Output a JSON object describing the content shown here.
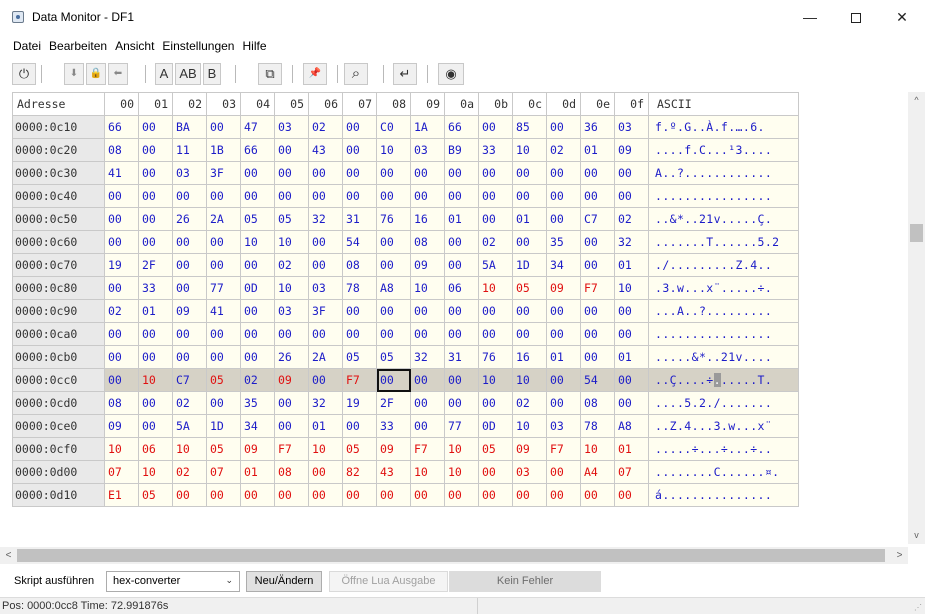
{
  "window": {
    "title": "Data Monitor - DF1",
    "minimize_glyph": "—",
    "close_glyph": "✕"
  },
  "menu": [
    "Datei",
    "Bearbeiten",
    "Ansicht",
    "Einstellungen",
    "Hilfe"
  ],
  "toolbar": {
    "power": "⏻",
    "nav_down": "⬇",
    "nav_lock": "🔒",
    "nav_left": "⬅",
    "fmt_a": "A",
    "fmt_ab": "AB",
    "fmt_b": "B",
    "window_icon": "⧉",
    "pin_icon": "📌",
    "search_icon": "⌕",
    "enter_icon": "↵",
    "eye_icon": "◉"
  },
  "grid": {
    "address_header": "Adresse",
    "ascii_header": "ASCII",
    "column_headers": [
      "00",
      "01",
      "02",
      "03",
      "04",
      "05",
      "06",
      "07",
      "08",
      "09",
      "0a",
      "0b",
      "0c",
      "0d",
      "0e",
      "0f"
    ],
    "selected": {
      "row": 11,
      "col": 8
    },
    "highlight_row": 11,
    "rows": [
      {
        "address": "0000:0c10",
        "bytes": [
          "66",
          "00",
          "BA",
          "00",
          "47",
          "03",
          "02",
          "00",
          "C0",
          "1A",
          "66",
          "00",
          "85",
          "00",
          "36",
          "03"
        ],
        "changed": [],
        "ascii": "f.º.G..À.f.….6."
      },
      {
        "address": "0000:0c20",
        "bytes": [
          "08",
          "00",
          "11",
          "1B",
          "66",
          "00",
          "43",
          "00",
          "10",
          "03",
          "B9",
          "33",
          "10",
          "02",
          "01",
          "09"
        ],
        "changed": [],
        "ascii": "....f.C...¹3...."
      },
      {
        "address": "0000:0c30",
        "bytes": [
          "41",
          "00",
          "03",
          "3F",
          "00",
          "00",
          "00",
          "00",
          "00",
          "00",
          "00",
          "00",
          "00",
          "00",
          "00",
          "00"
        ],
        "changed": [],
        "ascii": "A..?............"
      },
      {
        "address": "0000:0c40",
        "bytes": [
          "00",
          "00",
          "00",
          "00",
          "00",
          "00",
          "00",
          "00",
          "00",
          "00",
          "00",
          "00",
          "00",
          "00",
          "00",
          "00"
        ],
        "changed": [],
        "ascii": "................"
      },
      {
        "address": "0000:0c50",
        "bytes": [
          "00",
          "00",
          "26",
          "2A",
          "05",
          "05",
          "32",
          "31",
          "76",
          "16",
          "01",
          "00",
          "01",
          "00",
          "C7",
          "02"
        ],
        "changed": [],
        "ascii": "..&*..21v.....Ç."
      },
      {
        "address": "0000:0c60",
        "bytes": [
          "00",
          "00",
          "00",
          "00",
          "10",
          "10",
          "00",
          "54",
          "00",
          "08",
          "00",
          "02",
          "00",
          "35",
          "00",
          "32"
        ],
        "changed": [],
        "ascii": ".......T......5.2"
      },
      {
        "address": "0000:0c70",
        "bytes": [
          "19",
          "2F",
          "00",
          "00",
          "00",
          "02",
          "00",
          "08",
          "00",
          "09",
          "00",
          "5A",
          "1D",
          "34",
          "00",
          "01"
        ],
        "changed": [],
        "ascii": "./.........Z.4.."
      },
      {
        "address": "0000:0c80",
        "bytes": [
          "00",
          "33",
          "00",
          "77",
          "0D",
          "10",
          "03",
          "78",
          "A8",
          "10",
          "06",
          "10",
          "05",
          "09",
          "F7",
          "10"
        ],
        "changed": [
          11,
          12,
          13,
          14
        ],
        "ascii": ".3.w...x¨.....÷."
      },
      {
        "address": "0000:0c90",
        "bytes": [
          "02",
          "01",
          "09",
          "41",
          "00",
          "03",
          "3F",
          "00",
          "00",
          "00",
          "00",
          "00",
          "00",
          "00",
          "00",
          "00"
        ],
        "changed": [],
        "ascii": "...A..?........."
      },
      {
        "address": "0000:0ca0",
        "bytes": [
          "00",
          "00",
          "00",
          "00",
          "00",
          "00",
          "00",
          "00",
          "00",
          "00",
          "00",
          "00",
          "00",
          "00",
          "00",
          "00"
        ],
        "changed": [],
        "ascii": "................"
      },
      {
        "address": "0000:0cb0",
        "bytes": [
          "00",
          "00",
          "00",
          "00",
          "00",
          "26",
          "2A",
          "05",
          "05",
          "32",
          "31",
          "76",
          "16",
          "01",
          "00",
          "01"
        ],
        "changed": [],
        "ascii": ".....&*..21v...."
      },
      {
        "address": "0000:0cc0",
        "bytes": [
          "00",
          "10",
          "C7",
          "05",
          "02",
          "09",
          "00",
          "F7",
          "00",
          "00",
          "00",
          "10",
          "10",
          "00",
          "54",
          "00"
        ],
        "changed": [
          1,
          3,
          5,
          7
        ],
        "ascii_pre": "..Ç....÷",
        "ascii_sel": ".",
        "ascii_post": ".....T."
      },
      {
        "address": "0000:0cd0",
        "bytes": [
          "08",
          "00",
          "02",
          "00",
          "35",
          "00",
          "32",
          "19",
          "2F",
          "00",
          "00",
          "00",
          "02",
          "00",
          "08",
          "00"
        ],
        "changed": [],
        "ascii": "....5.2./......."
      },
      {
        "address": "0000:0ce0",
        "bytes": [
          "09",
          "00",
          "5A",
          "1D",
          "34",
          "00",
          "01",
          "00",
          "33",
          "00",
          "77",
          "0D",
          "10",
          "03",
          "78",
          "A8"
        ],
        "changed": [],
        "ascii": "..Z.4...3.w...x¨"
      },
      {
        "address": "0000:0cf0",
        "bytes": [
          "10",
          "06",
          "10",
          "05",
          "09",
          "F7",
          "10",
          "05",
          "09",
          "F7",
          "10",
          "05",
          "09",
          "F7",
          "10",
          "01"
        ],
        "changed": [
          0,
          1,
          2,
          3,
          4,
          5,
          6,
          7,
          8,
          9,
          10,
          11,
          12,
          13,
          14,
          15
        ],
        "ascii": ".....÷...÷...÷.."
      },
      {
        "address": "0000:0d00",
        "bytes": [
          "07",
          "10",
          "02",
          "07",
          "01",
          "08",
          "00",
          "82",
          "43",
          "10",
          "10",
          "00",
          "03",
          "00",
          "A4",
          "07"
        ],
        "changed": [
          0,
          1,
          2,
          3,
          4,
          5,
          6,
          7,
          8,
          9,
          10,
          11,
          12,
          13,
          14,
          15
        ],
        "ascii": "........C......¤."
      },
      {
        "address": "0000:0d10",
        "bytes": [
          "E1",
          "05",
          "00",
          "00",
          "00",
          "00",
          "00",
          "00",
          "00",
          "00",
          "00",
          "00",
          "00",
          "00",
          "00",
          "00"
        ],
        "changed": [
          0,
          1,
          2,
          3,
          4,
          5,
          6,
          7,
          8,
          9,
          10,
          11,
          12,
          13,
          14,
          15
        ],
        "ascii": "á..............."
      }
    ]
  },
  "scroll": {
    "up": "^",
    "down": "v",
    "left": "<",
    "right": ">"
  },
  "bottom": {
    "run_script_label": "Skript ausführen",
    "script_value": "hex-converter",
    "chevron": "⌄",
    "new_change_button": "Neu/Ändern",
    "open_lua_button": "Öffne Lua Ausgabe",
    "status": "Kein Fehler"
  },
  "statusbar": {
    "text": "Pos: 0000:0cc8 Time: 72.991876s",
    "grip": "⋰"
  },
  "colors": {
    "byte_text": "#1c1cc8",
    "changed_byte": "#e01010",
    "cell_bg": "#fffef0",
    "highlight_row_bg": "#d6d2c6",
    "address_bg": "#e9e9e9"
  }
}
